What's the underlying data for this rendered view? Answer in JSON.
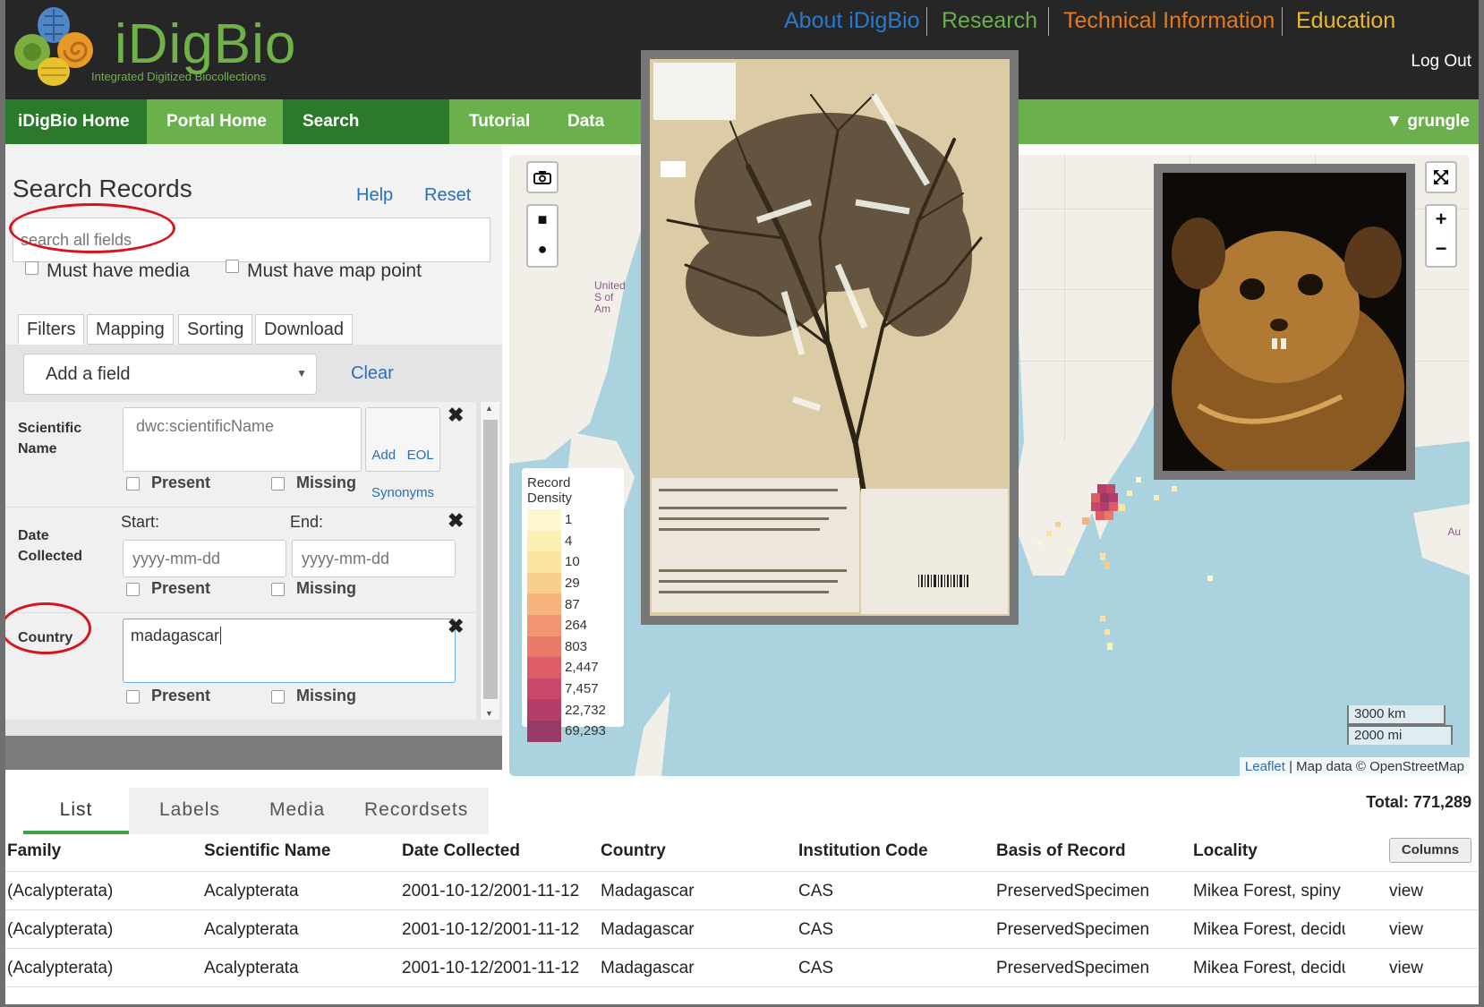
{
  "header": {
    "logo_text": "iDigBio",
    "logo_subtitle": "Integrated Digitized Biocollections",
    "links": [
      {
        "label": "About iDigBio",
        "color": "#2a7ac9"
      },
      {
        "label": "Research",
        "color": "#6ab04c"
      },
      {
        "label": "Technical Information",
        "color": "#e07b1f"
      },
      {
        "label": "Education",
        "color": "#e8b92a"
      }
    ],
    "logout": "Log Out"
  },
  "nav": {
    "items": [
      "iDigBio Home",
      "Portal Home",
      "Search Records",
      "Tutorial",
      "Data"
    ],
    "user": "▼ grungle"
  },
  "search": {
    "title": "Search Records",
    "help": "Help",
    "reset": "Reset",
    "placeholder": "search all fields",
    "must_have_media": "Must have media",
    "must_have_map_point": "Must have map point",
    "tabs": [
      "Filters",
      "Mapping",
      "Sorting",
      "Download"
    ],
    "add_field": "Add a field",
    "clear": "Clear"
  },
  "filters": {
    "scientific_name": {
      "label_line1": "Scientific",
      "label_line2": "Name",
      "placeholder": "dwc:scientificName",
      "add_eol_1": "Add   EOL",
      "add_eol_2": "Synonyms"
    },
    "date_collected": {
      "label_line1": "Date",
      "label_line2": "Collected",
      "start_label": "Start:",
      "end_label": "End:",
      "start_placeholder": "yyyy-mm-dd",
      "end_placeholder": "yyyy-mm-dd"
    },
    "country": {
      "label": "Country",
      "value": "madagascar"
    },
    "present": "Present",
    "missing": "Missing",
    "remove": "✖"
  },
  "map": {
    "legend_title": "Record Density",
    "legend": [
      {
        "value": "1",
        "color": "#fdf7cf"
      },
      {
        "value": "4",
        "color": "#fcefb4"
      },
      {
        "value": "10",
        "color": "#fbe3a0"
      },
      {
        "value": "29",
        "color": "#f9ce8c"
      },
      {
        "value": "87",
        "color": "#f6b47c"
      },
      {
        "value": "264",
        "color": "#f19670"
      },
      {
        "value": "803",
        "color": "#e97a6a"
      },
      {
        "value": "2,447",
        "color": "#dc5d68"
      },
      {
        "value": "7,457",
        "color": "#c94869"
      },
      {
        "value": "22,732",
        "color": "#b23e69"
      },
      {
        "value": "69,293",
        "color": "#983a66"
      }
    ],
    "scale_km": "3000 km",
    "scale_mi": "2000 mi",
    "attribution_link": "Leaflet",
    "attribution_text": " | Map data © OpenStreetMap",
    "label_us": "United S of Am",
    "label_au": "Au",
    "zoom_in": "+",
    "zoom_out": "−"
  },
  "results": {
    "tabs": [
      "List",
      "Labels",
      "Media",
      "Recordsets"
    ],
    "total": "Total: 771,289",
    "columns_button": "Columns",
    "headers": [
      "Family",
      "Scientific Name",
      "Date Collected",
      "Country",
      "Institution Code",
      "Basis of Record",
      "Locality"
    ],
    "rows": [
      [
        "(Acalypterata)",
        "Acalypterata",
        "2001-10-12/2001-11-12",
        "Madagascar",
        "CAS",
        "PreservedSpecimen",
        "Mikea Forest, spiny f...",
        "view"
      ],
      [
        "(Acalypterata)",
        "Acalypterata",
        "2001-10-12/2001-11-12",
        "Madagascar",
        "CAS",
        "PreservedSpecimen",
        "Mikea Forest, decidu...",
        "view"
      ],
      [
        "(Acalypterata)",
        "Acalypterata",
        "2001-10-12/2001-11-12",
        "Madagascar",
        "CAS",
        "PreservedSpecimen",
        "Mikea Forest, decidu...",
        "view"
      ]
    ]
  }
}
